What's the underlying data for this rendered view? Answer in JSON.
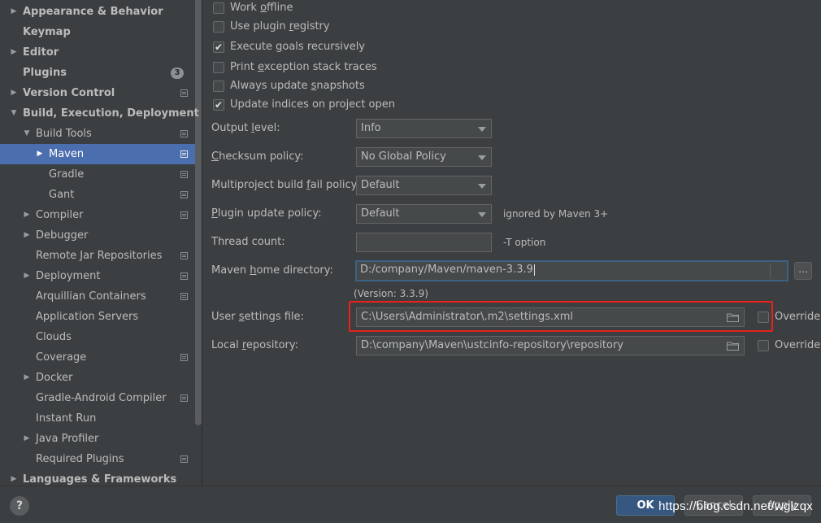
{
  "sidebar": {
    "items": [
      {
        "label": "Appearance & Behavior",
        "arrow": "▶",
        "bold": true
      },
      {
        "label": "Keymap",
        "arrow": "",
        "bold": true
      },
      {
        "label": "Editor",
        "arrow": "▶",
        "bold": true
      },
      {
        "label": "Plugins",
        "arrow": "",
        "bold": true,
        "badge": "3"
      },
      {
        "label": "Version Control",
        "arrow": "▶",
        "bold": true,
        "icon": "project-icon"
      },
      {
        "label": "Build, Execution, Deployment",
        "arrow": "▼",
        "bold": true
      },
      {
        "label": "Build Tools",
        "arrow": "▼",
        "icon": "project-icon"
      },
      {
        "label": "Maven",
        "arrow": "▶",
        "icon": "project-icon",
        "selected": true
      },
      {
        "label": "Gradle",
        "arrow": "",
        "icon": "project-icon"
      },
      {
        "label": "Gant",
        "arrow": "",
        "icon": "project-icon"
      },
      {
        "label": "Compiler",
        "arrow": "▶",
        "icon": "project-icon"
      },
      {
        "label": "Debugger",
        "arrow": "▶"
      },
      {
        "label": "Remote Jar Repositories",
        "arrow": "",
        "icon": "project-icon"
      },
      {
        "label": "Deployment",
        "arrow": "▶",
        "icon": "project-icon"
      },
      {
        "label": "Arquillian Containers",
        "arrow": "",
        "icon": "project-icon"
      },
      {
        "label": "Application Servers",
        "arrow": ""
      },
      {
        "label": "Clouds",
        "arrow": ""
      },
      {
        "label": "Coverage",
        "arrow": "",
        "icon": "project-icon"
      },
      {
        "label": "Docker",
        "arrow": "▶"
      },
      {
        "label": "Gradle-Android Compiler",
        "arrow": "",
        "icon": "project-icon"
      },
      {
        "label": "Instant Run",
        "arrow": ""
      },
      {
        "label": "Java Profiler",
        "arrow": "▶"
      },
      {
        "label": "Required Plugins",
        "arrow": "",
        "icon": "project-icon"
      },
      {
        "label": "Languages & Frameworks",
        "arrow": "▶",
        "bold": true
      }
    ]
  },
  "options": {
    "work_offline": {
      "pre": "Work ",
      "mn": "o",
      "post": "ffline",
      "checked": false
    },
    "use_plugin_registry": {
      "pre": "Use plugin ",
      "mn": "r",
      "post": "egistry",
      "checked": false
    },
    "execute_goals_recursively": {
      "pre": "Execute ",
      "mn": "g",
      "post": "oals recursively",
      "checked": true
    },
    "print_exception_stack_traces": {
      "pre": "Print ",
      "mn": "e",
      "post": "xception stack traces",
      "checked": false
    },
    "always_update_snapshots": {
      "pre": "Always update ",
      "mn": "s",
      "post": "napshots",
      "checked": false
    },
    "update_indices": {
      "pre": "",
      "mn": "",
      "post": "Update indices on project open",
      "checked": true
    }
  },
  "form": {
    "output_level": {
      "pre": "Output ",
      "mn": "l",
      "post": "evel:",
      "value": "Info"
    },
    "checksum_policy": {
      "pre": "",
      "mn": "C",
      "post": "hecksum policy:",
      "value": "No Global Policy"
    },
    "multiproject_fail_policy": {
      "pre": "Multiproject build ",
      "mn": "f",
      "post": "ail policy:",
      "value": "Default"
    },
    "plugin_update_policy": {
      "pre": "",
      "mn": "P",
      "post": "lugin update policy:",
      "value": "Default",
      "hint": "ignored by Maven 3+"
    },
    "thread_count": {
      "label": "Thread count:",
      "value": "",
      "hint": "-T option"
    },
    "maven_home": {
      "pre": "Maven ",
      "mn": "h",
      "post": "ome directory:",
      "value": "D:/company/Maven/maven-3.3.9",
      "version": "(Version: 3.3.9)",
      "browse": "..."
    },
    "user_settings": {
      "pre": "User ",
      "mn": "s",
      "post": "ettings file:",
      "value": "C:\\Users\\Administrator\\.m2\\settings.xml",
      "override": "Override"
    },
    "local_repository": {
      "pre": "Local ",
      "mn": "r",
      "post": "epository:",
      "value": "D:\\company\\Maven\\ustcinfo-repository\\repository",
      "override": "Override"
    }
  },
  "footer": {
    "help": "?",
    "ok": "OK",
    "cancel": "Cancel",
    "apply": "Apply",
    "watermark": "https://blog.csdn.net/wglzqx"
  },
  "colors": {
    "background": "#3c3f41",
    "selection": "#4b6eaf",
    "highlight_box": "#e8221b",
    "focus_border": "#3d6185"
  }
}
